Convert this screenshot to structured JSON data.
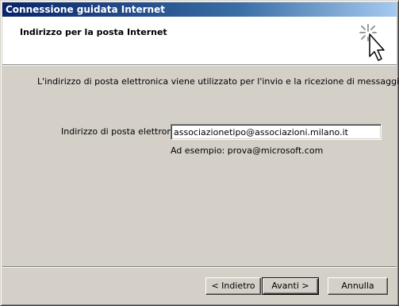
{
  "window": {
    "title": "Connessione guidata Internet"
  },
  "header": {
    "title": "Indirizzo per la posta Internet",
    "icon": "wizard-sparkle-cursor-icon"
  },
  "main": {
    "intro_text": "L'indirizzo di posta elettronica viene utilizzato per l'invio e la ricezione di messaggi.",
    "email_label": "Indirizzo di posta elettronica:",
    "email_value": "associazionetipo@associazioni.milano.it",
    "example_text": "Ad esempio: prova@microsoft.com"
  },
  "buttons": {
    "back_label": "< Indietro",
    "next_label": "Avanti >",
    "cancel_label": "Annulla"
  },
  "colors": {
    "title_bar_start": "#0a246a",
    "title_bar_end": "#a6caf0",
    "dialog_face": "#d4d0c8",
    "header_background": "#ffffff"
  }
}
